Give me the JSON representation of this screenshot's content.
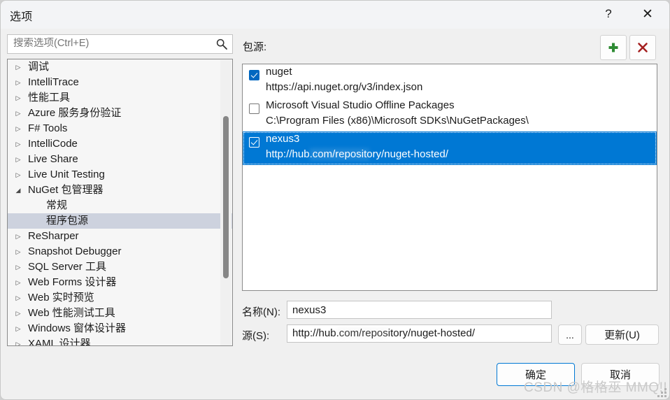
{
  "window": {
    "title": "选项",
    "help_icon": "?",
    "close_icon": "✕"
  },
  "search": {
    "placeholder": "搜索选项(Ctrl+E)",
    "value": "",
    "icon": "search-icon"
  },
  "tree": {
    "items": [
      {
        "label": "调试",
        "arrow": "▷",
        "child": false,
        "selected": false
      },
      {
        "label": "IntelliTrace",
        "arrow": "▷",
        "child": false,
        "selected": false
      },
      {
        "label": "性能工具",
        "arrow": "▷",
        "child": false,
        "selected": false
      },
      {
        "label": "Azure 服务身份验证",
        "arrow": "▷",
        "child": false,
        "selected": false
      },
      {
        "label": "F# Tools",
        "arrow": "▷",
        "child": false,
        "selected": false
      },
      {
        "label": "IntelliCode",
        "arrow": "▷",
        "child": false,
        "selected": false
      },
      {
        "label": "Live Share",
        "arrow": "▷",
        "child": false,
        "selected": false
      },
      {
        "label": "Live Unit Testing",
        "arrow": "▷",
        "child": false,
        "selected": false
      },
      {
        "label": "NuGet 包管理器",
        "arrow": "◢",
        "child": false,
        "selected": false
      },
      {
        "label": "常规",
        "arrow": "",
        "child": true,
        "selected": false
      },
      {
        "label": "程序包源",
        "arrow": "",
        "child": true,
        "selected": true
      },
      {
        "label": "ReSharper",
        "arrow": "▷",
        "child": false,
        "selected": false
      },
      {
        "label": "Snapshot Debugger",
        "arrow": "▷",
        "child": false,
        "selected": false
      },
      {
        "label": "SQL Server 工具",
        "arrow": "▷",
        "child": false,
        "selected": false
      },
      {
        "label": "Web Forms 设计器",
        "arrow": "▷",
        "child": false,
        "selected": false
      },
      {
        "label": "Web 实时预览",
        "arrow": "▷",
        "child": false,
        "selected": false
      },
      {
        "label": "Web 性能测试工具",
        "arrow": "▷",
        "child": false,
        "selected": false
      },
      {
        "label": "Windows 窗体设计器",
        "arrow": "▷",
        "child": false,
        "selected": false
      },
      {
        "label": "XAML 设计器",
        "arrow": "▷",
        "child": false,
        "selected": false
      }
    ]
  },
  "sources": {
    "label": "包源:",
    "add_label": "+",
    "remove_label": "✕",
    "add_color": "#2e8b33",
    "remove_color": "#a42020",
    "selection_color": "#0078d4",
    "rows": [
      {
        "name": "nuget",
        "url": "https://api.nuget.org/v3/index.json",
        "checked": true,
        "selected": false
      },
      {
        "name": "Microsoft Visual Studio Offline Packages",
        "url": "C:\\Program Files (x86)\\Microsoft SDKs\\NuGetPackages\\",
        "checked": false,
        "selected": false
      },
      {
        "name": "nexus3",
        "url_prefix": "http://hub",
        "url_redacted": "░░░░░░░░",
        "url_suffix": ".com/repository/nuget-hosted/",
        "checked": true,
        "selected": true
      }
    ]
  },
  "form": {
    "name_label": "名称(N):",
    "name_value": "nexus3",
    "source_label": "源(S):",
    "source_prefix": "http://hub",
    "source_redacted": "░░░░░░░",
    "source_suffix": ".com/repository/nuget-hosted/",
    "browse_label": "...",
    "update_label": "更新(U)"
  },
  "footer": {
    "ok_label": "确定",
    "cancel_label": "取消",
    "watermark": "CSDN @格格巫 MMQ!!"
  }
}
